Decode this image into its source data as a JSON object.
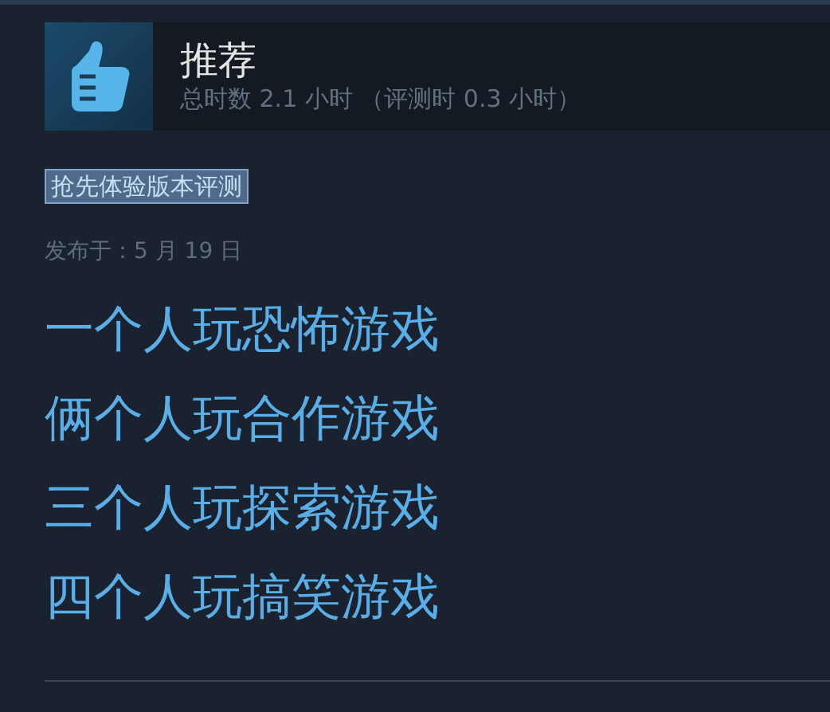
{
  "review": {
    "recommended": true,
    "verdict": "推荐",
    "hours": "总时数 2.1 小时 （评测时 0.3 小时）",
    "badge": "抢先体验版本评测",
    "posted": "发布于：5 月 19 日",
    "lines": [
      "一个人玩恐怖游戏",
      "俩个人玩合作游戏",
      "三个人玩探索游戏",
      "四个人玩搞笑游戏"
    ]
  }
}
